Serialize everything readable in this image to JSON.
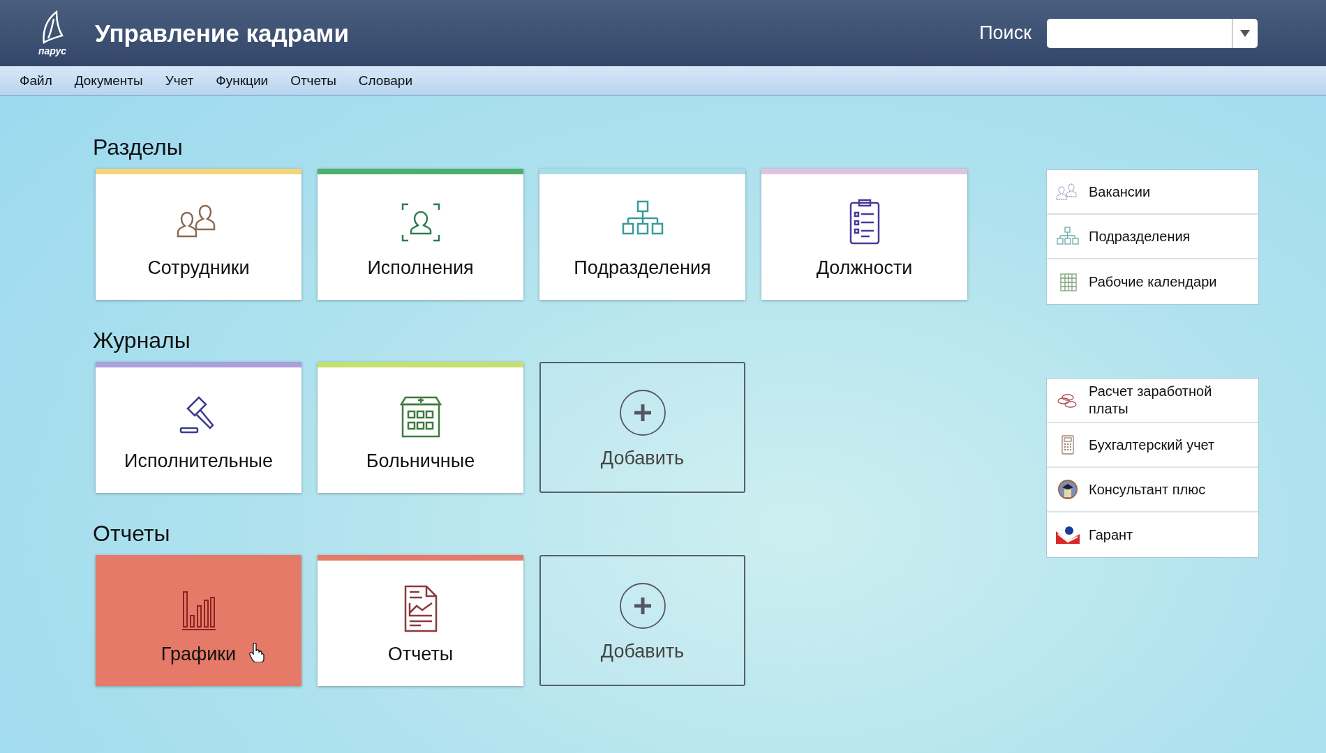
{
  "app": {
    "logo_text": "парус",
    "title": "Управление кадрами"
  },
  "search": {
    "label": "Поиск"
  },
  "menu": [
    "Файл",
    "Документы",
    "Учет",
    "Функции",
    "Отчеты",
    "Словари"
  ],
  "groups": [
    {
      "title": "Разделы",
      "tiles": [
        {
          "kind": "section",
          "label": "Сотрудники",
          "color": "#f5d57a",
          "selected": false
        },
        {
          "kind": "section",
          "label": "Исполнения",
          "color": "#4caf6a",
          "selected": false
        },
        {
          "kind": "section",
          "label": "Подразделения",
          "color": "#a8dce8",
          "selected": false
        },
        {
          "kind": "section",
          "label": "Должности",
          "color": "#e2c2e4",
          "selected": false
        }
      ]
    },
    {
      "title": "Журналы",
      "tiles": [
        {
          "kind": "section",
          "label": "Исполнительные",
          "color": "#a9a0dc",
          "selected": false
        },
        {
          "kind": "section",
          "label": "Больничные",
          "color": "#c6e070",
          "selected": false
        },
        {
          "kind": "add",
          "label": "Добавить",
          "selected": false
        }
      ]
    },
    {
      "title": "Отчеты",
      "tiles": [
        {
          "kind": "section",
          "label": "Графики",
          "color": "#e57a68",
          "selected": true
        },
        {
          "kind": "section",
          "label": "Отчеты",
          "color": "#e57a68",
          "selected": false
        },
        {
          "kind": "add",
          "label": "Добавить",
          "selected": false
        }
      ]
    }
  ],
  "link_panels": [
    {
      "items": [
        "Вакансии",
        "Подразделения",
        "Рабочие календари"
      ]
    },
    {
      "items": [
        "Расчет заработной платы",
        "Бухгалтерский учет",
        "Консультант плюс",
        "Гарант"
      ]
    }
  ]
}
